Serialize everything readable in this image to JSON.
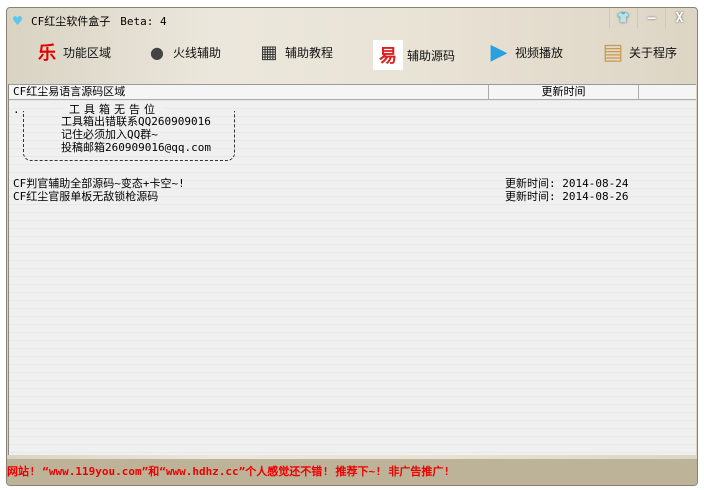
{
  "window": {
    "title": "CF红尘软件盒子",
    "version": "Beta: 4"
  },
  "controls": {
    "skin": "👕",
    "minimize": "—",
    "close": "X"
  },
  "toolbar": [
    {
      "label": "功能区域",
      "icon": "乐",
      "color": "#e00000"
    },
    {
      "label": "火线辅助",
      "icon": "●",
      "color": "#444444"
    },
    {
      "label": "辅助教程",
      "icon": "▦",
      "color": "#333333"
    },
    {
      "label": "辅助源码",
      "icon": "易",
      "color": "#e02020"
    },
    {
      "label": "视频播放",
      "icon": "▶",
      "color": "#2aa0e0"
    },
    {
      "label": "关于程序",
      "icon": "▤",
      "color": "#c89a50"
    }
  ],
  "list": {
    "headers": [
      "CF红尘易语言源码区域",
      "更新时间",
      ""
    ],
    "notice": {
      "title": "工具箱无告位",
      "lines": [
        "工具箱出错联系QQ260909016",
        "记住必须加入QQ群~",
        "投稿邮箱260909016@qq.com"
      ]
    },
    "rows": [
      {
        "name": "CF判官辅助全部源码~变态+卡空~!",
        "time": "更新时间: 2014-08-24"
      },
      {
        "name": "CF红尘官服单板无敌锁枪源码",
        "time": "更新时间: 2014-08-26"
      }
    ]
  },
  "status": {
    "text": "网站! “www.119you.com”和“www.hdhz.cc”个人感觉还不错! 推荐下~! 非广告推广!"
  }
}
